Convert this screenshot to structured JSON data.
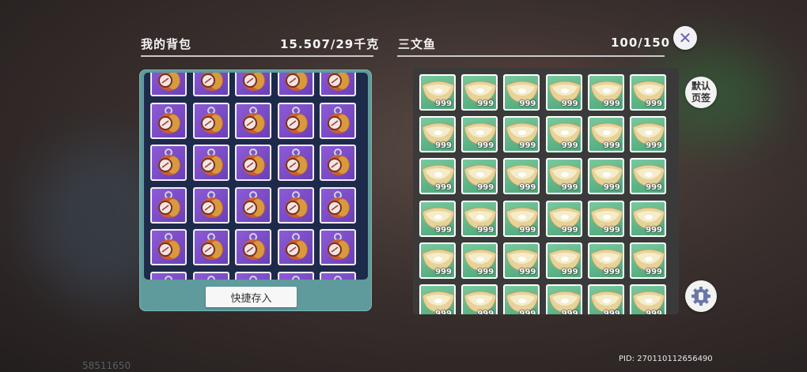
{
  "backpack": {
    "title": "我的背包",
    "weight": "15.507/29千克"
  },
  "storage": {
    "title": "三文鱼",
    "count": "100/150"
  },
  "buttons": {
    "close_symbol": "✕",
    "default_tab": [
      "默认",
      "页签"
    ],
    "quick_store": "快捷存入"
  },
  "left_grid": {
    "columns": 5,
    "item": "watch-item-icon"
  },
  "right_grid": {
    "columns": 6,
    "rows": 6,
    "item": "salmon-bowl-icon",
    "quantity": "999"
  },
  "footer": {
    "pid": "PID: 270110112656490",
    "uid": "58511650"
  },
  "colors": {
    "purple_slot": "#7a4cc8",
    "green_slot": "#5ab585",
    "panel_teal": "#5f9a9c"
  }
}
